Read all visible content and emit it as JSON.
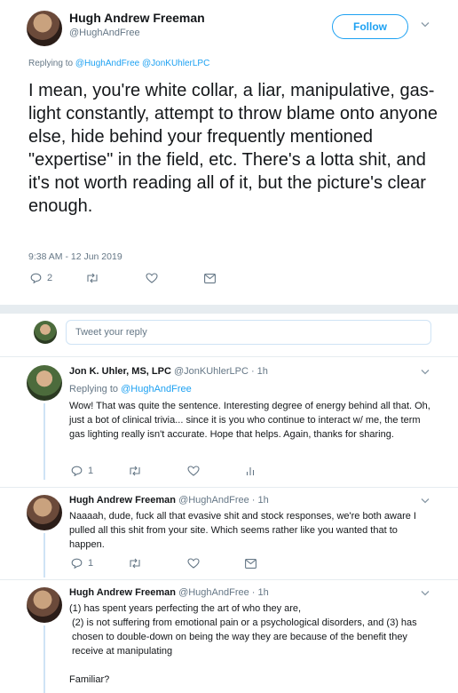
{
  "main_tweet": {
    "display_name": "Hugh Andrew Freeman",
    "handle": "@HughAndFree",
    "follow_label": "Follow",
    "replying_to_label": "Replying to",
    "replying_to_handles": "@HughAndFree @JonKUhlerLPC",
    "text": "I mean, you're white collar, a liar, manipulative, gas-light constantly, attempt to throw blame onto anyone else, hide behind your frequently mentioned \"expertise\" in the field, etc. There's a lotta shit, and it's not worth reading all of it, but the picture's clear enough.",
    "timestamp": "9:38 AM - 12 Jun 2019",
    "reply_count": "2"
  },
  "compose": {
    "placeholder": "Tweet your reply"
  },
  "replies": [
    {
      "display_name": "Jon K. Uhler, MS, LPC",
      "handle_time": "@JonKUhlerLPC · 1h",
      "replying_to_label": "Replying to",
      "replying_to_handle": "@HughAndFree",
      "text": "Wow! That was quite the sentence. Interesting degree of energy behind all that. Oh, just a bot of clinical trivia... since it is you who continue to interact w/ me, the term gas lighting really isn't accurate. Hope that helps. Again, thanks for sharing.",
      "reply_count": "1"
    },
    {
      "display_name": "Hugh Andrew Freeman",
      "handle_time": "@HughAndFree · 1h",
      "text": "Naaaah, dude, fuck all that evasive shit and stock responses, we're both aware I pulled all this shit from your site. Which seems rather like you wanted that to happen.",
      "reply_count": "1"
    },
    {
      "display_name": "Hugh Andrew Freeman",
      "handle_time": "@HughAndFree · 1h",
      "text_lines": [
        "(1) has spent years perfecting the art of who they are,",
        "(2) is not suffering from emotional pain or a psychological disorders, and (3) has chosen to double-down on being the way they are because of the benefit they receive at manipulating",
        "",
        "Familiar?"
      ]
    }
  ],
  "icons": {
    "reply": "reply-icon",
    "retweet": "retweet-icon",
    "like": "heart-icon",
    "message": "envelope-icon",
    "analytics": "analytics-icon",
    "caret": "chevron-down-icon"
  },
  "colors": {
    "accent": "#1da1f2",
    "muted": "#657786",
    "divider": "#e6ecf0"
  }
}
